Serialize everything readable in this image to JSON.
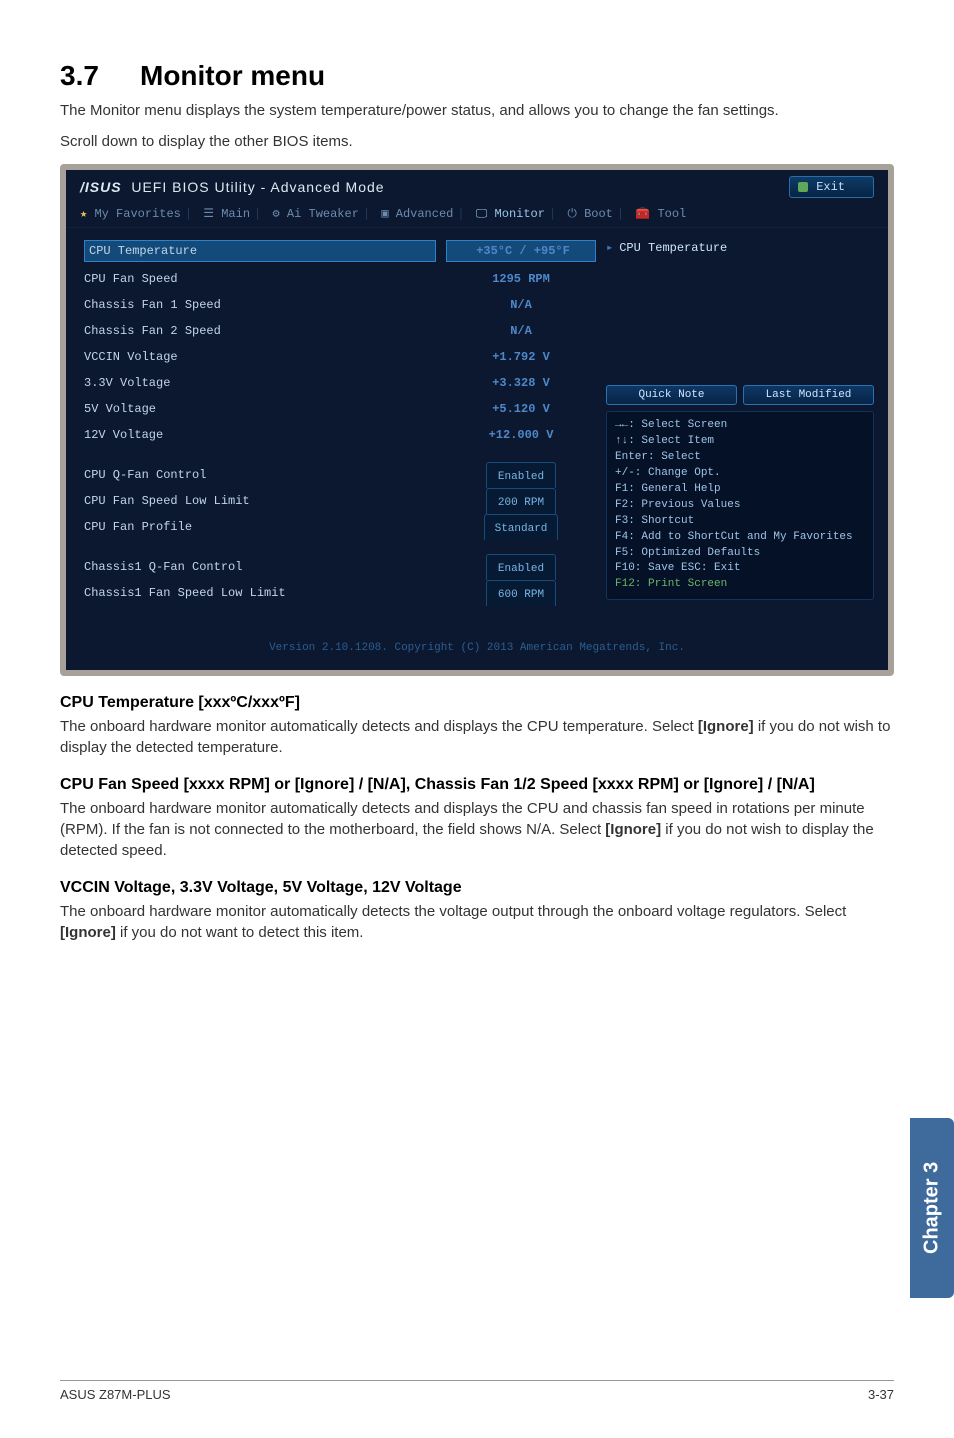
{
  "section": {
    "number": "3.7",
    "title": "Monitor menu"
  },
  "intro": {
    "p1": "The Monitor menu displays the system temperature/power status, and allows you to change the fan settings.",
    "p2": "Scroll down to display the other BIOS items."
  },
  "bios": {
    "brand": "UEFI BIOS Utility - Advanced Mode",
    "exit": "Exit",
    "tabs": {
      "t1": "My Favorites",
      "t2": "Main",
      "t3": "Ai Tweaker",
      "t4": "Advanced",
      "t5": "Monitor",
      "t6": "Boot",
      "t7": "Tool"
    },
    "rows": {
      "r1": "CPU Temperature",
      "r2": "CPU Fan Speed",
      "r3": "Chassis Fan 1 Speed",
      "r4": "Chassis Fan 2 Speed",
      "r5": "VCCIN Voltage",
      "r6": "3.3V Voltage",
      "r7": "5V Voltage",
      "r8": "12V Voltage",
      "r9": "CPU Q-Fan Control",
      "r10": "CPU Fan Speed Low Limit",
      "r11": "CPU Fan Profile",
      "r12": "Chassis1 Q-Fan Control",
      "r13": "Chassis1 Fan Speed Low Limit"
    },
    "vals": {
      "v1": "+35°C / +95°F",
      "v2": "1295 RPM",
      "v3": "N/A",
      "v4": "N/A",
      "v5": "+1.792 V",
      "v6": "+3.328 V",
      "v7": "+5.120 V",
      "v8": "+12.000 V",
      "v9": "Enabled",
      "v10": "200 RPM",
      "v11": "Standard",
      "v12": "Enabled",
      "v13": "600 RPM"
    },
    "right": {
      "title": "CPU Temperature",
      "quick_note": "Quick Note",
      "last_mod": "Last Modified",
      "help1": "→←: Select Screen",
      "help2": "↑↓: Select Item",
      "help3": "Enter: Select",
      "help4": "+/-: Change Opt.",
      "help5": "F1: General Help",
      "help6": "F2: Previous Values",
      "help7": "F3: Shortcut",
      "help8": "F4: Add to ShortCut and My Favorites",
      "help9": "F5: Optimized Defaults",
      "help10": "F10: Save  ESC: Exit",
      "help11": "F12: Print Screen"
    },
    "footer": "Version 2.10.1208. Copyright (C) 2013 American Megatrends, Inc."
  },
  "desc": {
    "h1": "CPU Temperature [xxxºC/xxxºF]",
    "p1a": "The onboard hardware monitor automatically detects and displays the CPU temperature. Select ",
    "p1b": "[Ignore]",
    "p1c": " if you do not wish to display the detected temperature.",
    "h2": "CPU Fan Speed [xxxx RPM] or [Ignore] / [N/A], Chassis Fan 1/2 Speed [xxxx RPM] or [Ignore] / [N/A]",
    "p2a": "The onboard hardware monitor automatically detects and displays the CPU and chassis fan speed in rotations per minute (RPM). If the fan is not connected to the motherboard, the field shows N/A. Select ",
    "p2b": "[Ignore]",
    "p2c": " if you do not wish to display the detected speed.",
    "h3": "VCCIN Voltage, 3.3V Voltage, 5V Voltage, 12V Voltage",
    "p3a": "The onboard hardware monitor automatically detects the voltage output through the onboard voltage regulators. Select ",
    "p3b": "[Ignore]",
    "p3c": " if you do not want to detect this item."
  },
  "chapter_tab": "Chapter 3",
  "footer": {
    "left": "ASUS Z87M-PLUS",
    "right": "3-37"
  }
}
